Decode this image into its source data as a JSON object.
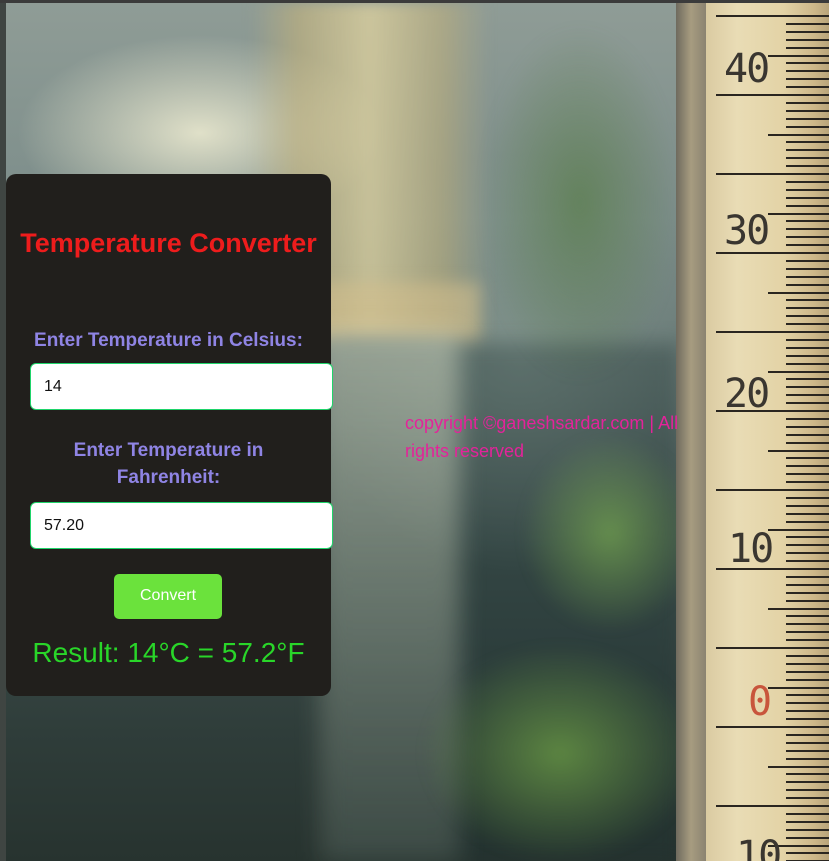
{
  "converter": {
    "title": "Temperature Converter",
    "celsius_label": "Enter Temperature in Celsius:",
    "celsius_value": "14",
    "fahrenheit_label": "Enter Temperature in Fahrenheit:",
    "fahrenheit_value": "57.20",
    "convert_label": "Convert",
    "result_text": "Result: 14°C = 57.2°F"
  },
  "footer": {
    "copyright": "copyright ©ganeshsardar.com | All rights reserved"
  },
  "background": {
    "image_description_icon": "thermometer-background-image",
    "thermometer_scale": [
      "40",
      "30",
      "20",
      "10",
      "0",
      "10"
    ]
  },
  "colors": {
    "title": "#ee1c1c",
    "label": "#8f84e4",
    "button": "#6be23c",
    "result": "#29d629",
    "copyright": "#e3239a",
    "card": "#211f1c"
  }
}
